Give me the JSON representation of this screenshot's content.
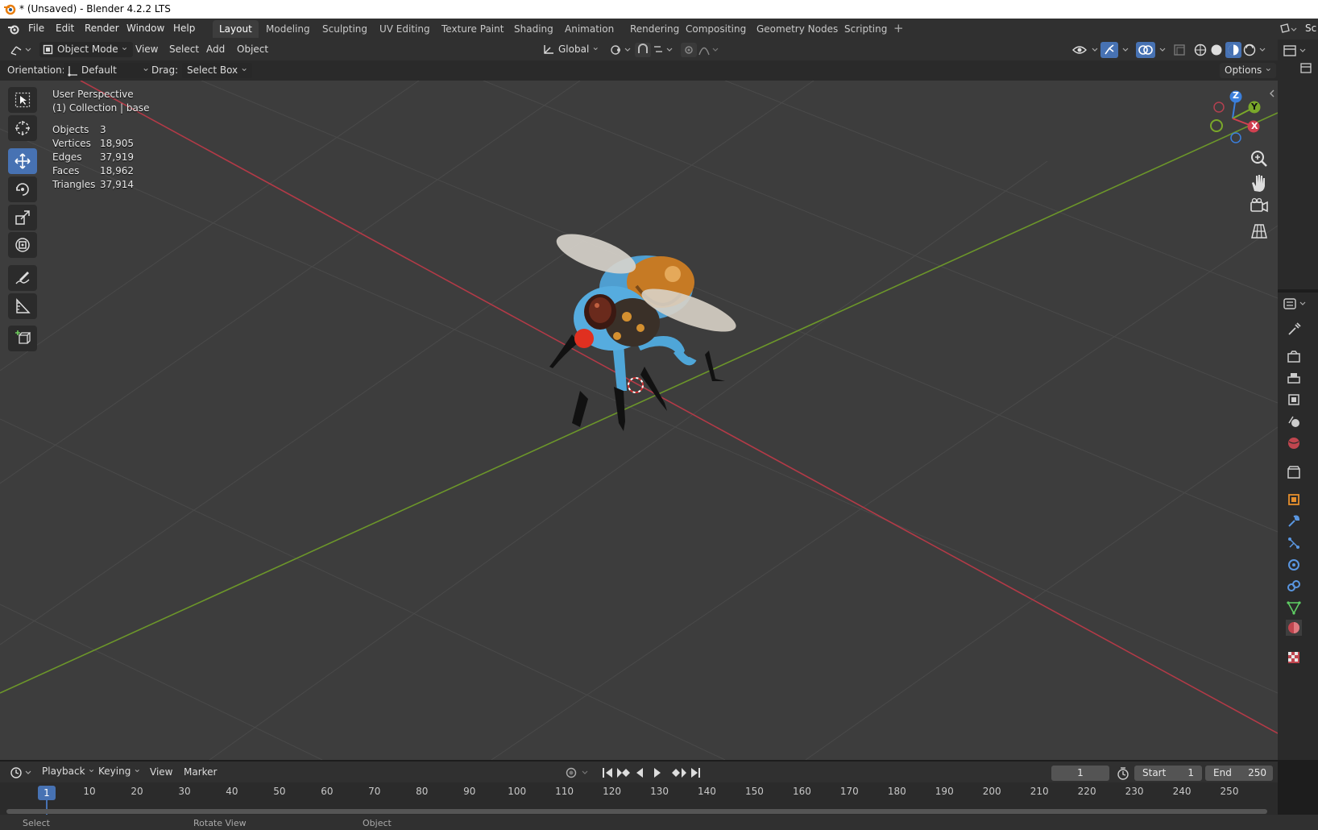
{
  "window": {
    "title": "* (Unsaved) - Blender 4.2.2 LTS"
  },
  "menu": [
    "File",
    "Edit",
    "Render",
    "Window",
    "Help"
  ],
  "workspaces": [
    "Layout",
    "Modeling",
    "Sculpting",
    "UV Editing",
    "Texture Paint",
    "Shading",
    "Animation",
    "Rendering",
    "Compositing",
    "Geometry Nodes",
    "Scripting"
  ],
  "workspace_add": "+",
  "active_workspace": "Layout",
  "header": {
    "mode": "Object Mode",
    "menus": [
      "View",
      "Select",
      "Add",
      "Object"
    ],
    "transform_orientation": "Global"
  },
  "tool_settings": {
    "orientation_label": "Orientation:",
    "orientation_value": "Default",
    "drag_label": "Drag:",
    "drag_value": "Select Box",
    "options": "Options"
  },
  "viewport": {
    "perspective": "User Perspective",
    "collection": "(1) Collection | base",
    "stats": [
      {
        "label": "Objects",
        "value": "3"
      },
      {
        "label": "Vertices",
        "value": "18,905"
      },
      {
        "label": "Edges",
        "value": "37,919"
      },
      {
        "label": "Faces",
        "value": "18,962"
      },
      {
        "label": "Triangles",
        "value": "37,914"
      }
    ],
    "axes": {
      "z": "Z",
      "y": "Y",
      "x": "X"
    }
  },
  "timeline": {
    "menus": [
      "Playback",
      "Keying",
      "View",
      "Marker"
    ],
    "current_frame": "1",
    "start_label": "Start",
    "start": "1",
    "end_label": "End",
    "end": "250",
    "ticks": [
      "1",
      "10",
      "20",
      "30",
      "40",
      "50",
      "60",
      "70",
      "80",
      "90",
      "100",
      "110",
      "120",
      "130",
      "140",
      "150",
      "160",
      "170",
      "180",
      "190",
      "200",
      "210",
      "220",
      "230",
      "240",
      "250"
    ]
  },
  "statusbar": {
    "left": "Select",
    "middle": "Rotate View",
    "right": "Object"
  },
  "right_header_text": "Sc",
  "colors": {
    "accent": "#4772b3",
    "x_axis": "#d04050",
    "y_axis": "#7aa82a",
    "z_axis": "#3b7fdc"
  }
}
